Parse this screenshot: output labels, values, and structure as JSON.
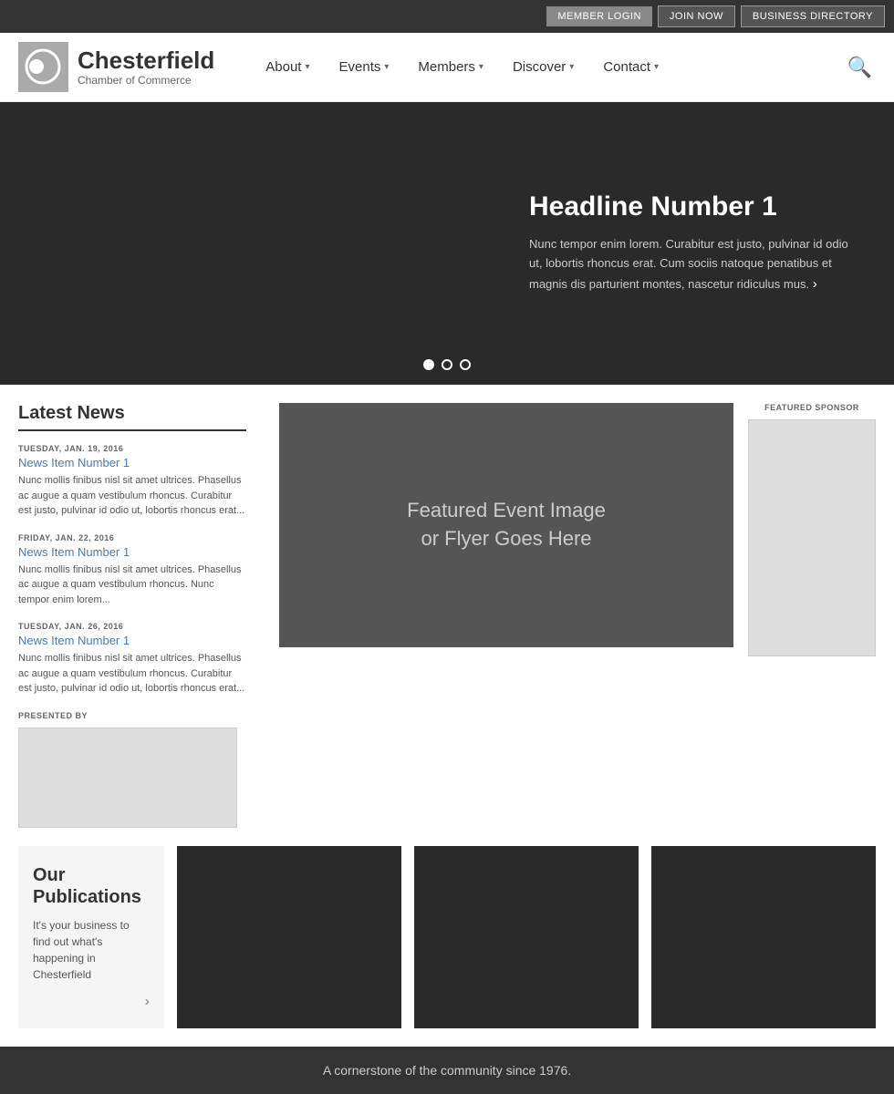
{
  "topbar": {
    "member_login": "MEMBER LOGIN",
    "join_now": "JOIN NOW",
    "business_directory": "BUSINESS DIRECTORY"
  },
  "header": {
    "logo_name": "Chesterfield",
    "logo_sub": "Chamber of Commerce",
    "nav": [
      {
        "label": "About",
        "id": "about"
      },
      {
        "label": "Events",
        "id": "events"
      },
      {
        "label": "Members",
        "id": "members"
      },
      {
        "label": "Discover",
        "id": "discover"
      },
      {
        "label": "Contact",
        "id": "contact"
      }
    ]
  },
  "hero": {
    "title": "Headline Number 1",
    "description": "Nunc tempor enim lorem. Curabitur est justo, pulvinar id odio ut, lobortis rhoncus erat. Cum sociis natoque penatibus et magnis dis parturient montes, nascetur ridiculus mus.",
    "dots": 3,
    "active_dot": 0
  },
  "news": {
    "section_title": "Latest News",
    "items": [
      {
        "date": "TUESDAY, JAN. 19, 2016",
        "title": "News Item Number 1",
        "text": "Nunc mollis finibus nisl sit amet ultrices. Phasellus ac augue a quam vestibulum rhoncus. Curabitur est justo, pulvinar id odio ut, lobortis rhoncus erat..."
      },
      {
        "date": "FRIDAY, JAN. 22, 2016",
        "title": "News Item Number 1",
        "text": "Nunc mollis finibus nisl sit amet ultrices. Phasellus ac augue a quam vestibulum rhoncus. Nunc tempor enim lorem..."
      },
      {
        "date": "TUESDAY, JAN. 26, 2016",
        "title": "News Item Number 1",
        "text": "Nunc mollis finibus nisl sit amet ultrices. Phasellus ac augue a quam vestibulum rhoncus. Curabitur est justo, pulvinar id odio ut, lobortis rhoncus erat..."
      }
    ],
    "presented_by": "PRESENTED BY"
  },
  "featured_event": {
    "text_line1": "Featured Event Image",
    "text_line2": "or Flyer Goes Here"
  },
  "featured_sponsor": {
    "label": "FEATURED SPONSOR"
  },
  "publications": {
    "title": "Our Publications",
    "description": "It's your business to find out what's happening in Chesterfield"
  },
  "footer": {
    "text": "A cornerstone of the community since 1976."
  }
}
